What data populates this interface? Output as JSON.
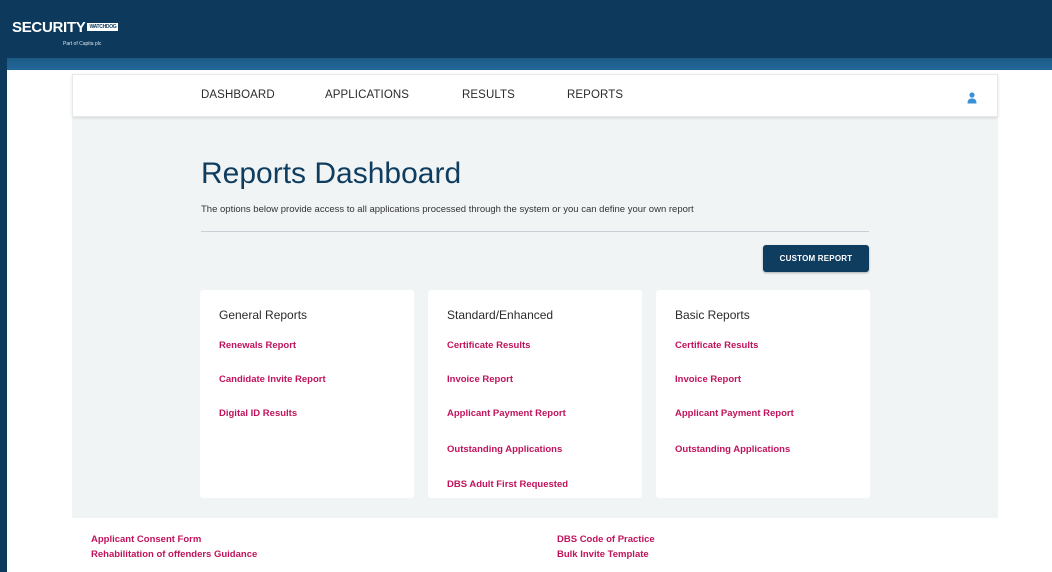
{
  "brand": {
    "logo_text": "SECURITY",
    "logo_badge": "WATCHDOG",
    "logo_sub": "Part of Capita plc",
    "primary_color": "#0d3a5c",
    "accent_color": "#c0135c"
  },
  "nav": {
    "items": [
      {
        "label": "DASHBOARD"
      },
      {
        "label": "APPLICATIONS"
      },
      {
        "label": "RESULTS"
      },
      {
        "label": "REPORTS"
      }
    ],
    "user_icon": "user-icon"
  },
  "main": {
    "title": "Reports Dashboard",
    "description": "The options below provide access to all applications processed through the system or you can define your own report",
    "custom_report_label": "CUSTOM REPORT"
  },
  "cards": [
    {
      "title": "General Reports",
      "links": [
        "Renewals Report",
        "Candidate Invite Report",
        "Digital ID Results"
      ]
    },
    {
      "title": "Standard/Enhanced",
      "links": [
        "Certificate Results",
        "Invoice Report",
        "Applicant Payment Report",
        "Outstanding Applications",
        "DBS Adult First Requested"
      ]
    },
    {
      "title": "Basic Reports",
      "links": [
        "Certificate Results",
        "Invoice Report",
        "Applicant Payment Report",
        "Outstanding Applications"
      ]
    }
  ],
  "footer": {
    "left": [
      "Applicant Consent Form",
      "Rehabilitation of offenders Guidance"
    ],
    "right": [
      "DBS Code of Practice",
      "Bulk Invite Template"
    ]
  }
}
